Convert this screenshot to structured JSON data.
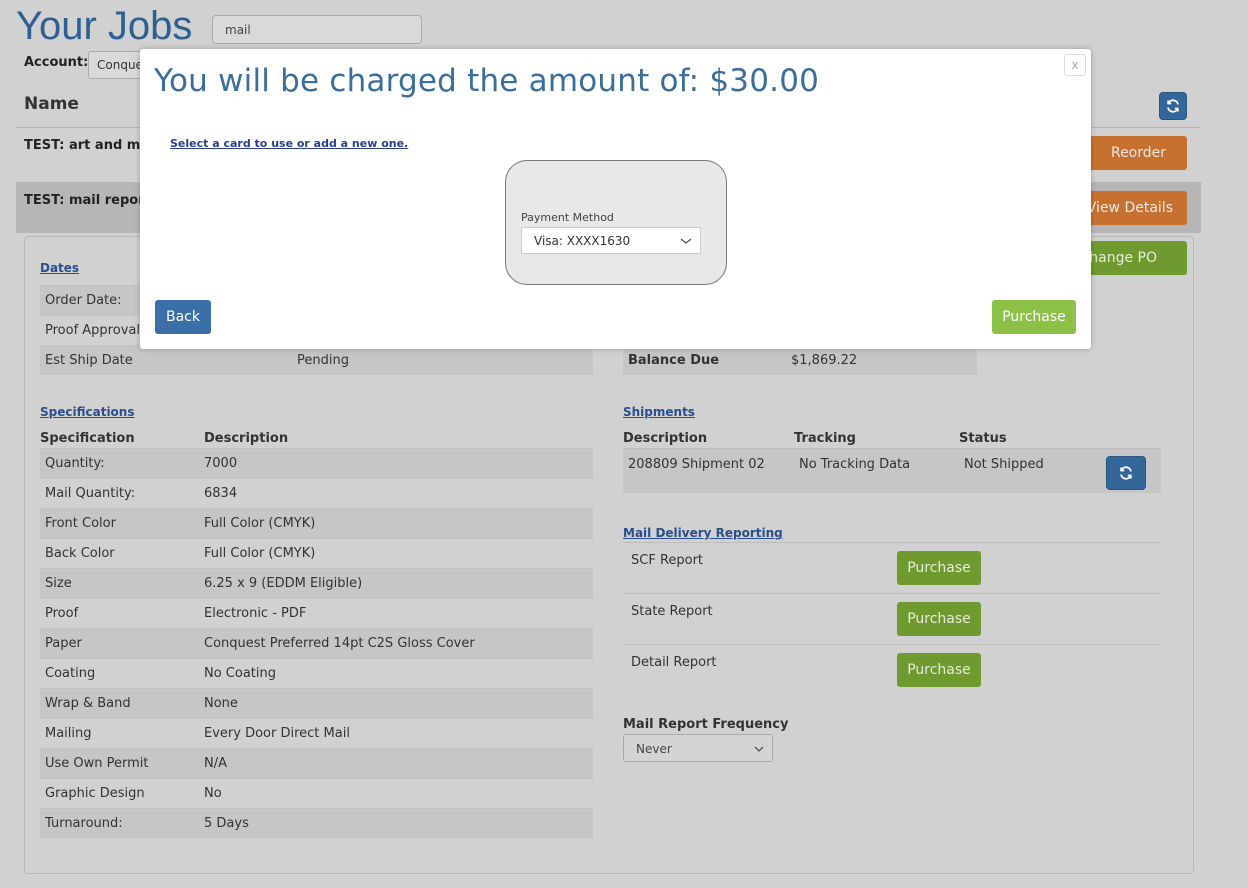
{
  "header": {
    "title": "Your Jobs",
    "search_value": "mail",
    "account_label": "Account:",
    "account_value": "Conquest"
  },
  "jobs_table": {
    "name_header": "Name",
    "jobs": [
      {
        "name": "TEST: art and mail",
        "action": "Reorder"
      },
      {
        "name": "TEST: mail report w",
        "action": "View Details",
        "secondary_action": "Change PO"
      }
    ]
  },
  "details": {
    "dates": {
      "title": "Dates",
      "rows": [
        {
          "label": "Order Date:",
          "value": ""
        },
        {
          "label": "Proof Approval",
          "value": ""
        },
        {
          "label": "Est Ship Date",
          "value": "Pending"
        }
      ]
    },
    "balance": {
      "label": "Balance Due",
      "value": "$1,869.22"
    },
    "specifications": {
      "title": "Specifications",
      "headers": [
        "Specification",
        "Description"
      ],
      "rows": [
        {
          "label": "Quantity:",
          "value": "7000"
        },
        {
          "label": "Mail Quantity:",
          "value": "6834"
        },
        {
          "label": "Front Color",
          "value": "Full Color (CMYK)"
        },
        {
          "label": "Back Color",
          "value": "Full Color (CMYK)"
        },
        {
          "label": "Size",
          "value": "6.25 x 9 (EDDM Eligible)"
        },
        {
          "label": "Proof",
          "value": "Electronic - PDF"
        },
        {
          "label": "Paper",
          "value": "Conquest Preferred 14pt C2S Gloss Cover"
        },
        {
          "label": "Coating",
          "value": "No Coating"
        },
        {
          "label": "Wrap & Band",
          "value": "None"
        },
        {
          "label": "Mailing",
          "value": "Every Door Direct Mail"
        },
        {
          "label": "Use Own Permit",
          "value": "N/A"
        },
        {
          "label": "Graphic Design",
          "value": "No"
        },
        {
          "label": "Turnaround:",
          "value": "5 Days"
        }
      ]
    },
    "shipments": {
      "title": "Shipments",
      "headers": [
        "Description",
        "Tracking",
        "Status"
      ],
      "rows": [
        {
          "description": "208809 Shipment 02",
          "tracking": "No Tracking Data",
          "status": "Not Shipped"
        }
      ]
    },
    "mail_reporting": {
      "title": "Mail Delivery Reporting",
      "reports": [
        {
          "label": "SCF Report",
          "button": "Purchase"
        },
        {
          "label": "State Report",
          "button": "Purchase"
        },
        {
          "label": "Detail Report",
          "button": "Purchase"
        }
      ],
      "frequency_label": "Mail Report Frequency",
      "frequency_value": "Never"
    }
  },
  "modal": {
    "title": "You will be charged the amount of: $30.00",
    "close_label": "x",
    "card_link": "Select a card to use or add a new one.",
    "payment_method_label": "Payment Method",
    "payment_method_value": "Visa: XXXX1630",
    "back_label": "Back",
    "purchase_label": "Purchase"
  },
  "colors": {
    "primary_blue": "#336699",
    "orange": "#c77130",
    "green": "#6f9a2f",
    "purchase_green": "#8dc047"
  },
  "icons": [
    "refresh-icon",
    "chevron-down-icon",
    "close-icon"
  ]
}
